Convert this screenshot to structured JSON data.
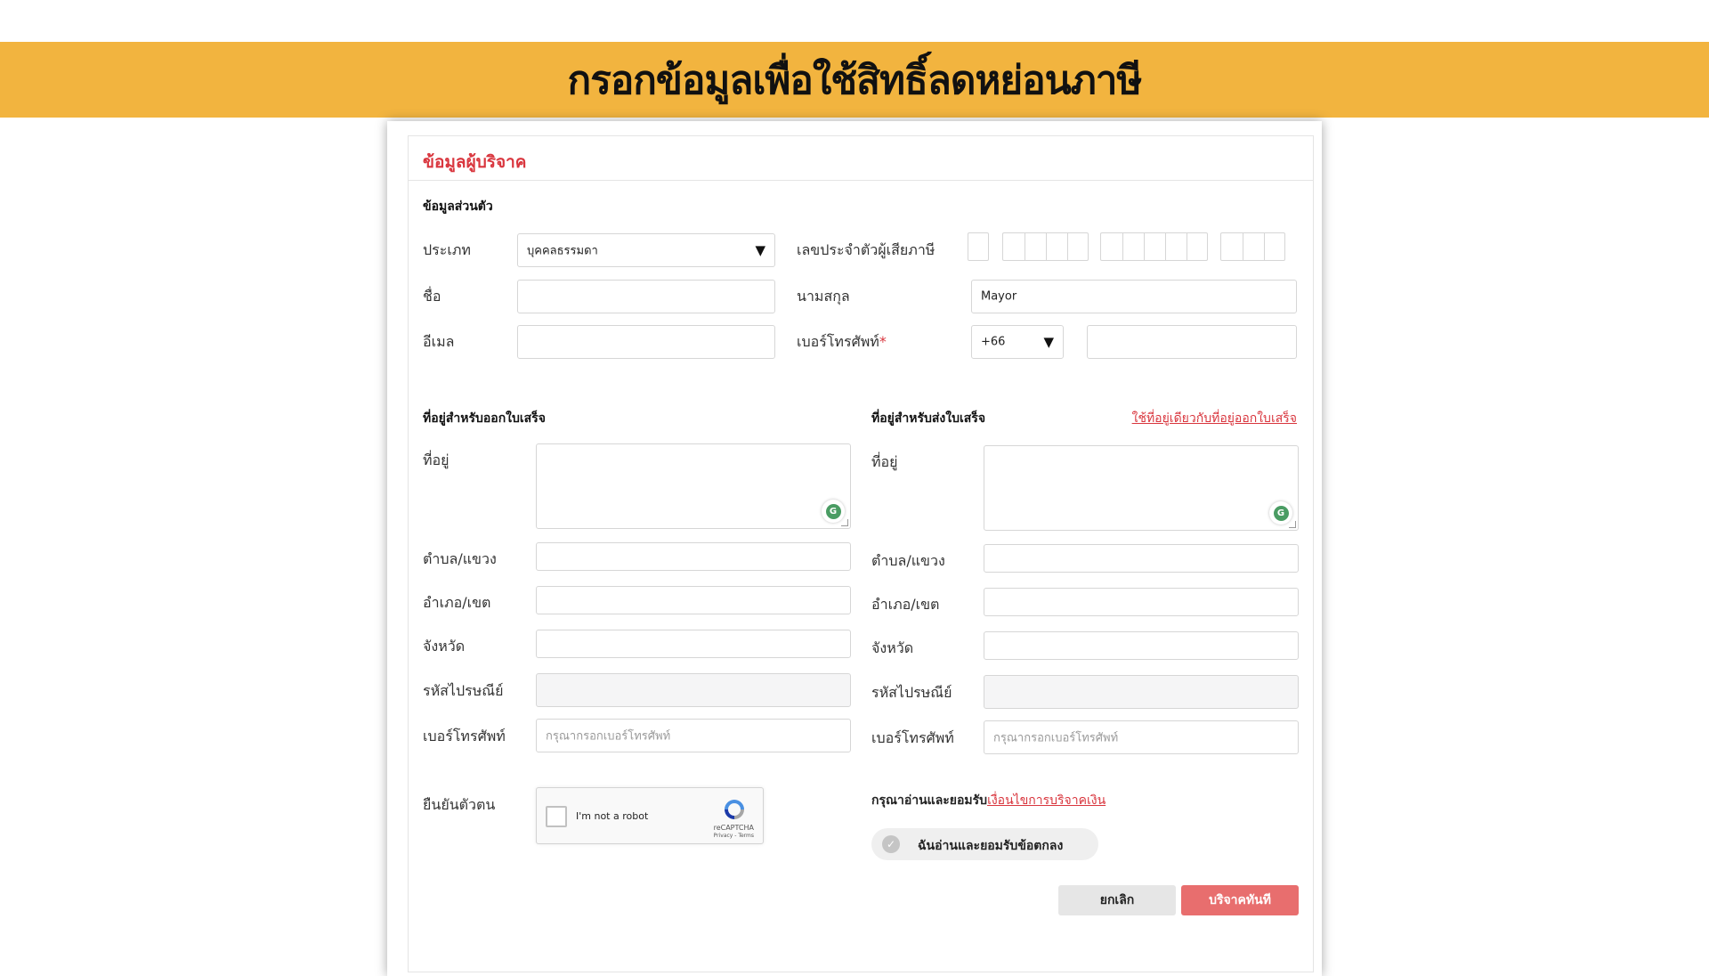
{
  "banner": {
    "title": "กรอกข้อมูลเพื่อใช้สิทธิ์ลดหย่อนภาษี"
  },
  "card": {
    "title": "ข้อมูลผู้บริจาค"
  },
  "personal": {
    "section_title": "ข้อมูลส่วนตัว",
    "type_label": "ประเภท",
    "type_value": "บุคคลธรรมดา",
    "taxid_label": "เลขประจำตัวผู้เสียภาษี",
    "firstname_label": "ชื่อ",
    "firstname_value": "",
    "lastname_label": "นามสกุล",
    "lastname_value": "Mayor",
    "email_label": "อีเมล",
    "email_value": "",
    "phone_label": "เบอร์โทรศัพท์",
    "required_mark": "*",
    "country_code": "+66",
    "phone_value": ""
  },
  "billing": {
    "section_title": "ที่อยู่สำหรับออกใบเสร็จ",
    "address_label": "ที่อยู่",
    "subdistrict_label": "ตำบล/แขวง",
    "district_label": "อำเภอ/เขต",
    "province_label": "จังหวัด",
    "postcode_label": "รหัสไปรษณีย์",
    "phone_label": "เบอร์โทรศัพท์",
    "phone_placeholder": "กรุณากรอกเบอร์โทรศัพท์"
  },
  "shipping": {
    "section_title": "ที่อยู่สำหรับส่งใบเสร็จ",
    "same_link": "ใช้ที่อยู่เดียวกับที่อยู่ออกใบเสร็จ",
    "address_label": "ที่อยู่",
    "subdistrict_label": "ตำบล/แขวง",
    "district_label": "อำเภอ/เขต",
    "province_label": "จังหวัด",
    "postcode_label": "รหัสไปรษณีย์",
    "phone_label": "เบอร์โทรศัพท์",
    "phone_placeholder": "กรุณากรอกเบอร์โทรศัพท์"
  },
  "verify": {
    "label": "ยืนยันตัวตน",
    "captcha_text": "I'm not a robot",
    "captcha_brand": "reCAPTCHA",
    "captcha_terms": "Privacy - Terms"
  },
  "terms": {
    "prefix": "กรุณาอ่านและยอมรับ",
    "link": "เงื่อนไขการบริจาคเงิน",
    "agree_text": "ฉันอ่านและยอมรับข้อตกลง"
  },
  "actions": {
    "cancel_label": "ยกเลิก",
    "donate_label": "บริจาคทันที"
  },
  "colors": {
    "banner": "#f2b43f",
    "accent_red": "#d9363e",
    "donate_button": "#e86e6e"
  }
}
